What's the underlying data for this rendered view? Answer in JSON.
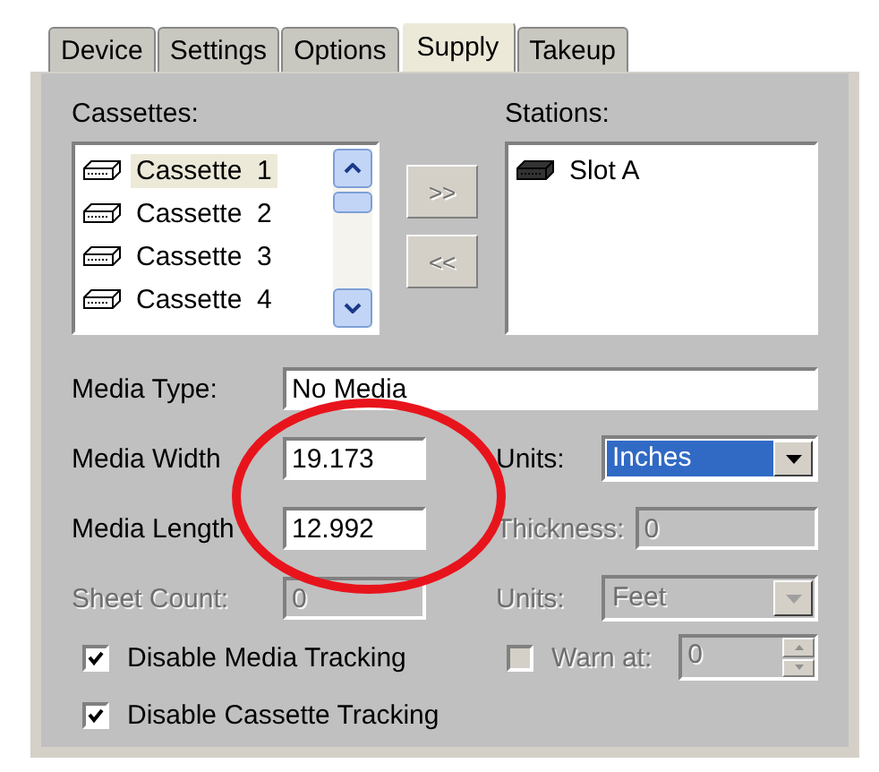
{
  "tabs": [
    {
      "label": "Device",
      "selected": false
    },
    {
      "label": "Settings",
      "selected": false
    },
    {
      "label": "Options",
      "selected": false
    },
    {
      "label": "Supply",
      "selected": true
    },
    {
      "label": "Takeup",
      "selected": false
    }
  ],
  "cassettes": {
    "label": "Cassettes:",
    "items": [
      {
        "label": "Cassette  1",
        "selected": true
      },
      {
        "label": "Cassette  2",
        "selected": false
      },
      {
        "label": "Cassette  3",
        "selected": false
      },
      {
        "label": "Cassette  4",
        "selected": false
      }
    ]
  },
  "transfer_buttons": [
    {
      "label": ">>",
      "disabled": true
    },
    {
      "label": "<<",
      "disabled": true
    }
  ],
  "stations": {
    "label": "Stations:",
    "items": [
      {
        "label": "Slot A",
        "selected": false
      }
    ]
  },
  "rows": [
    {
      "left": {
        "kind": "text",
        "label": "Media Type:",
        "value": "No Media",
        "disabled": false
      }
    },
    {
      "left": {
        "kind": "text",
        "label": "Media Width",
        "value": "19.173",
        "disabled": false
      },
      "right": {
        "kind": "combo",
        "label": "Units:",
        "value": "Inches",
        "disabled": false,
        "focused": true
      }
    },
    {
      "left": {
        "kind": "text",
        "label": "Media Length",
        "value": "12.992",
        "disabled": false
      },
      "right": {
        "kind": "text",
        "label": "Thickness:",
        "value": "0",
        "disabled": true
      }
    },
    {
      "left": {
        "kind": "text",
        "label": "Sheet Count:",
        "value": "0",
        "disabled": true
      },
      "right": {
        "kind": "combo",
        "label": "Units:",
        "value": "Feet",
        "disabled": true,
        "focused": false
      }
    },
    {
      "left": {
        "kind": "check",
        "label": "Disable Media Tracking",
        "checked": true,
        "disabled": false
      },
      "right": {
        "kind": "check_spin",
        "label": "Warn at:",
        "checked": false,
        "value": "0",
        "disabled": true
      }
    },
    {
      "left": {
        "kind": "check",
        "label": "Disable Cassette Tracking",
        "checked": true,
        "disabled": false
      }
    }
  ]
}
